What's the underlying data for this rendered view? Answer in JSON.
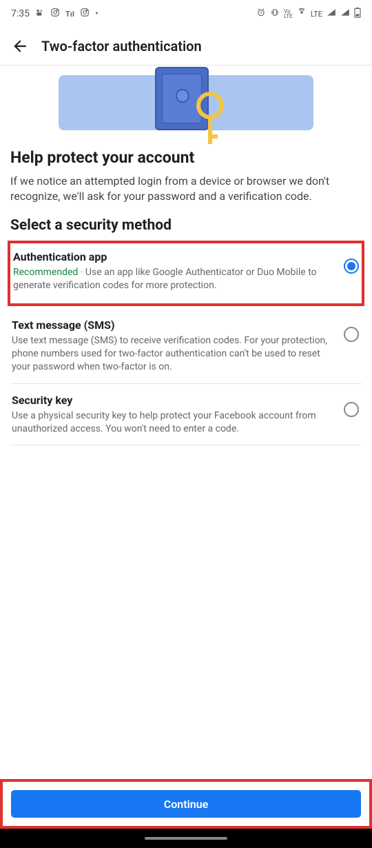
{
  "status_bar": {
    "time": "7:35",
    "network_label": "LTE"
  },
  "header": {
    "title": "Two-factor authentication"
  },
  "main": {
    "heading": "Help protect your account",
    "description": "If we notice an attempted login from a device or browser we don't recognize, we'll ask for your password and a verification code.",
    "section_heading": "Select a security method"
  },
  "methods": [
    {
      "title": "Authentication app",
      "recommended_label": "Recommended",
      "separator": " · ",
      "description": "Use an app like Google Authenticator or Duo Mobile to generate verification codes for more protection.",
      "selected": true,
      "highlighted": true
    },
    {
      "title": "Text message (SMS)",
      "description": "Use text message (SMS) to receive verification codes. For your protection, phone numbers used for two-factor authentication can't be used to reset your password when two-factor is on.",
      "selected": false,
      "highlighted": false
    },
    {
      "title": "Security key",
      "description": "Use a physical security key to help protect your Facebook account from unauthorized access. You won't need to enter a code.",
      "selected": false,
      "highlighted": false
    }
  ],
  "footer": {
    "continue_label": "Continue"
  }
}
